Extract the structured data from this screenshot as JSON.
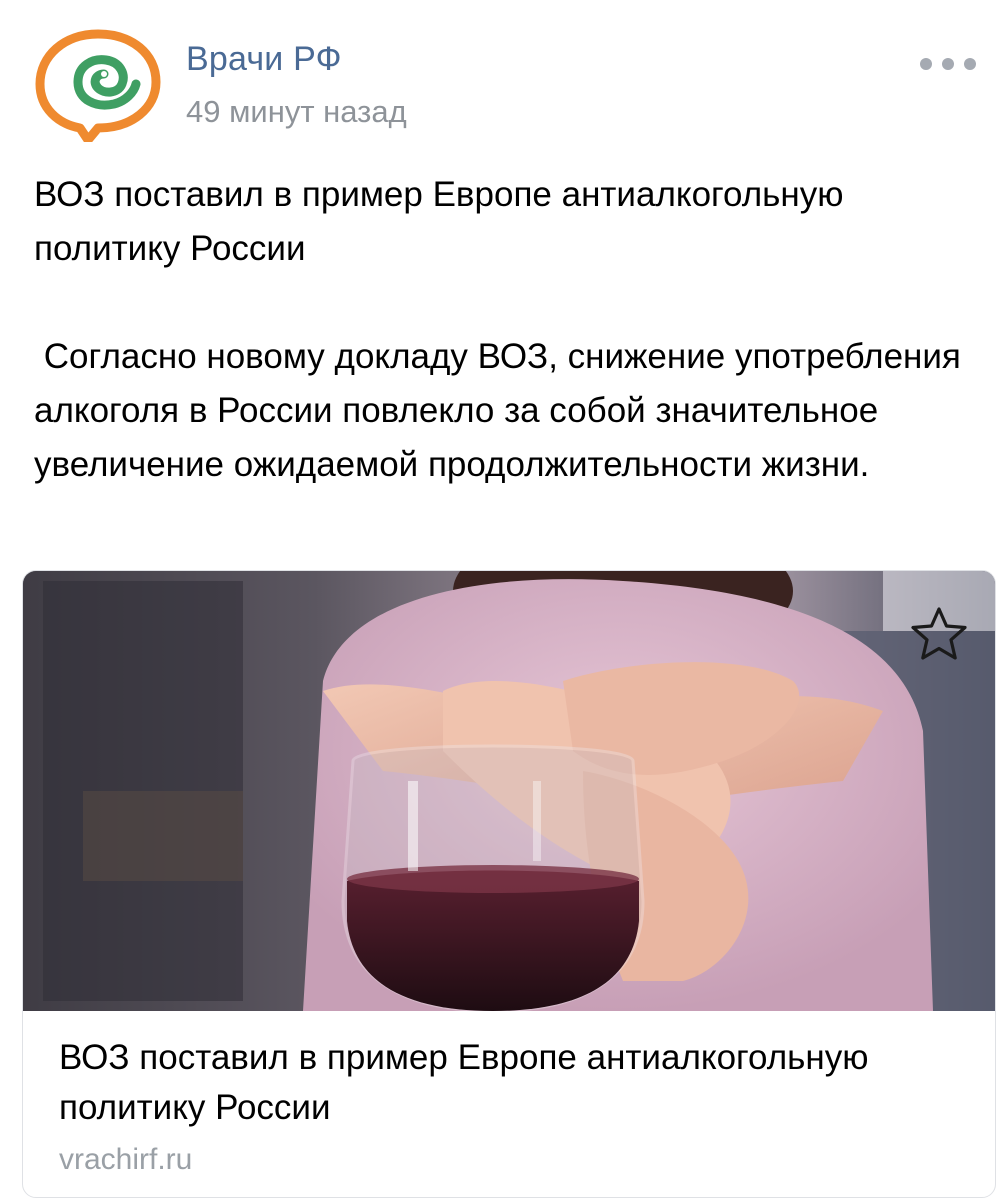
{
  "author": {
    "name": "Врачи РФ",
    "time": "49 минут назад",
    "avatar_icon": "vrachi-rf-snake-logo",
    "colors": {
      "orange": "#ef8a2f",
      "green": "#3f9f63",
      "name": "#4a6a95"
    }
  },
  "menu": {
    "icon": "more-horizontal-icon"
  },
  "post": {
    "headline": "ВОЗ поставил в пример Европе антиалкогольную политику России",
    "body": " Согласно новому докладу ВОЗ, снижение употребления алкоголя в России повлекло за собой значительное увеличение ожидаемой продолжительности жизни."
  },
  "link_card": {
    "image_icon": "woman-refusing-glass-of-wine-photo",
    "bookmark_icon": "star-icon",
    "title": "ВОЗ поставил в пример Европе антиалкогольную политику России",
    "domain": "vrachirf.ru"
  }
}
